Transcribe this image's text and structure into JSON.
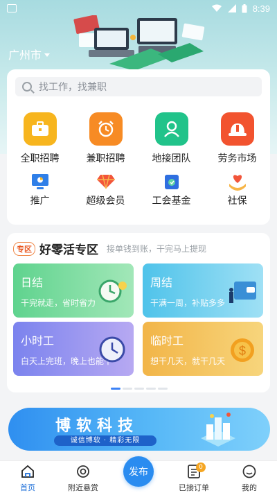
{
  "status_bar": {
    "time": "8:39"
  },
  "header": {
    "city": "广州市"
  },
  "search": {
    "placeholder": "找工作，找兼职"
  },
  "categories": [
    {
      "label": "全职招聘",
      "icon": "briefcase-icon",
      "color": "#f7b51e"
    },
    {
      "label": "兼职招聘",
      "icon": "alarm-clock-icon",
      "color": "#f78b24"
    },
    {
      "label": "地接团队",
      "icon": "team-icon",
      "color": "#21c38a"
    },
    {
      "label": "劳务市场",
      "icon": "hardhat-icon",
      "color": "#f2532f"
    }
  ],
  "services": [
    {
      "label": "推广",
      "icon": "promo-monitor-icon"
    },
    {
      "label": "超级会员",
      "icon": "diamond-icon"
    },
    {
      "label": "工会基金",
      "icon": "fund-wallet-icon"
    },
    {
      "label": "社保",
      "icon": "heart-hand-icon"
    }
  ],
  "zone": {
    "badge": "专区",
    "title": "好零活专区",
    "subtitle": "接单钱到账，干完马上提现",
    "tiles": [
      {
        "title": "日结",
        "desc": "干完就走，省时省力",
        "icon": "clock-icon"
      },
      {
        "title": "周结",
        "desc": "干满一周，补贴多多",
        "icon": "wallet-icon"
      },
      {
        "title": "小时工",
        "desc": "白天上完班，晚上也能干",
        "icon": "clock-icon"
      },
      {
        "title": "临时工",
        "desc": "想干几天，就干几天",
        "icon": "coin-icon"
      }
    ]
  },
  "banner": {
    "title": "博软科技",
    "slogan": "诚信博软 · 精彩无限"
  },
  "tabbar": {
    "items": [
      {
        "label": "首页",
        "icon": "home-icon",
        "active": true
      },
      {
        "label": "附近悬赏",
        "icon": "nearby-icon",
        "active": false
      },
      {
        "label": "发布",
        "icon": "publish-icon",
        "active": false
      },
      {
        "label": "已接订单",
        "icon": "orders-icon",
        "active": false,
        "badge": "0"
      },
      {
        "label": "我的",
        "icon": "profile-icon",
        "active": false
      }
    ]
  },
  "colors": {
    "accent": "#1e6fd9",
    "publish_button": "#2a8cf0"
  }
}
